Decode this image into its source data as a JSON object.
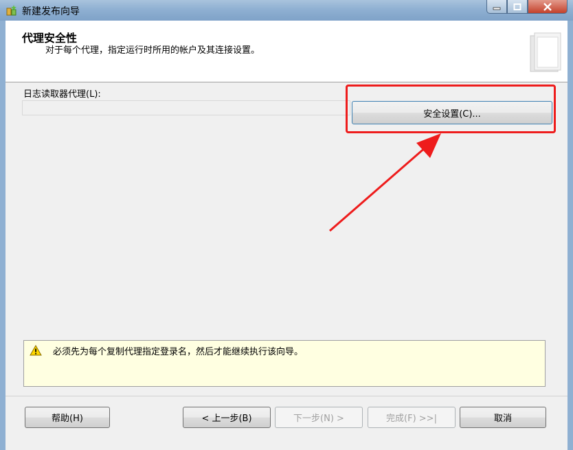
{
  "window": {
    "title": "新建发布向导",
    "icon": "wizard-icon",
    "controls": [
      "minimize-icon",
      "maximize-icon",
      "close-icon"
    ]
  },
  "header": {
    "title": "代理安全性",
    "subtitle": "对于每个代理，指定运行时所用的帐户及其连接设置。"
  },
  "agent": {
    "label": "日志读取器代理(L):",
    "value": "",
    "security_button": "安全设置(C)..."
  },
  "message": {
    "icon": "warning-icon",
    "text": "必须先为每个复制代理指定登录名，然后才能继续执行该向导。"
  },
  "buttons": {
    "help": "帮助(H)",
    "back": "< 上一步(B)",
    "next": "下一步(N) >",
    "finish": "完成(F) >>|",
    "cancel": "取消"
  },
  "annotation": {
    "color": "#ee1c1c"
  }
}
